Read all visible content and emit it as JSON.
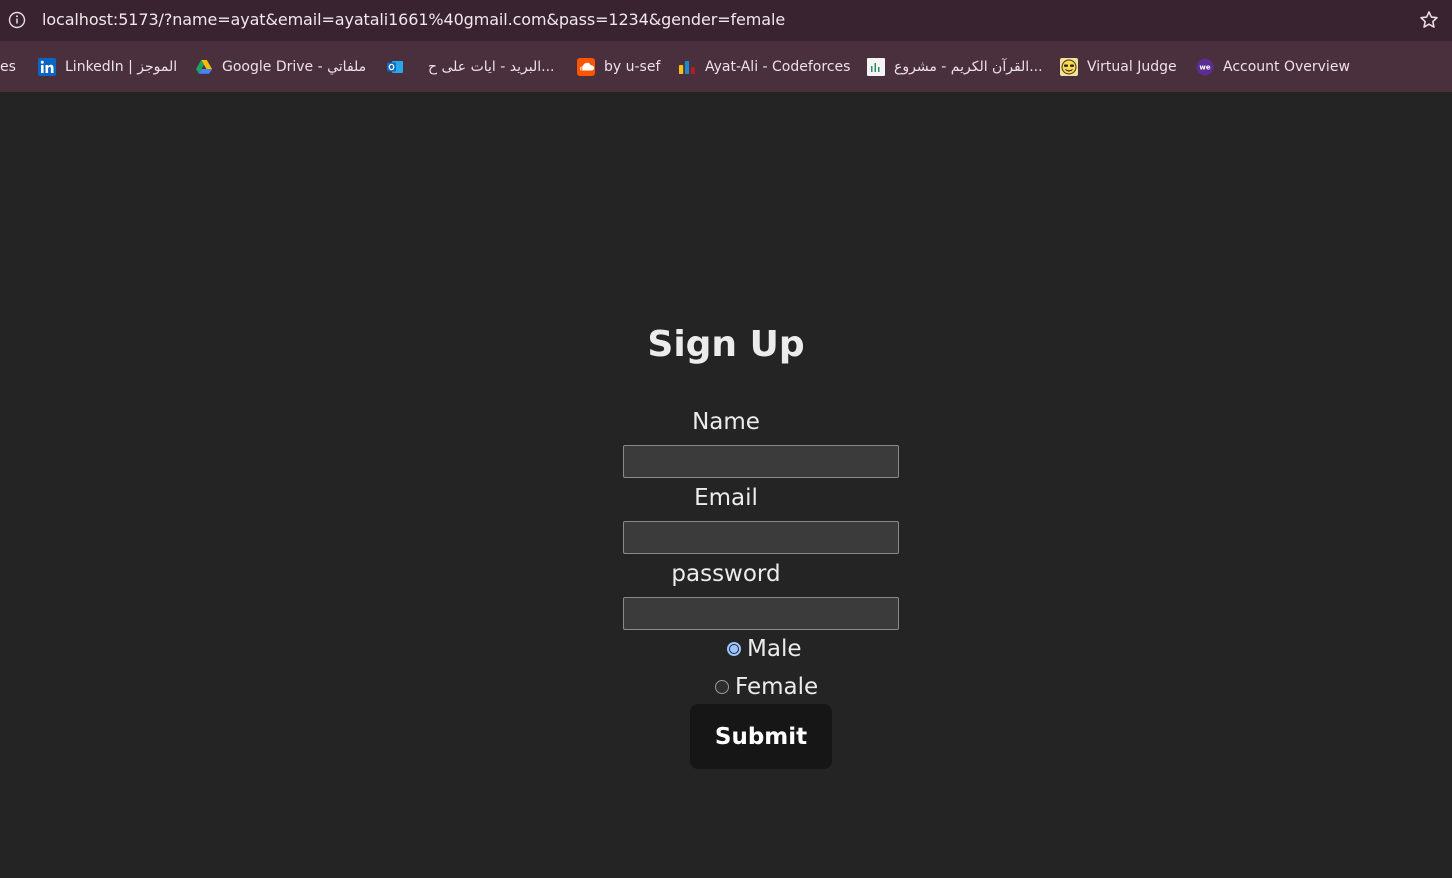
{
  "browser": {
    "url": "localhost:5173/?name=ayat&email=ayatali1661%40gmail.com&pass=1234&gender=female",
    "bookmarks": [
      {
        "label": "es",
        "icon": "folder-icon"
      },
      {
        "label": "LinkedIn | الموجز",
        "icon": "linkedin-icon",
        "color": "#0a66c2"
      },
      {
        "label": "Google Drive - ملفاتي",
        "icon": "google-drive-icon"
      },
      {
        "label": "",
        "icon": "outlook-icon",
        "color": "#0f6cbd"
      },
      {
        "label": "البريد - ايات على ح...",
        "icon": "mail-icon"
      },
      {
        "label": "by u-sef",
        "icon": "soundcloud-icon",
        "color": "#ff5500"
      },
      {
        "label": "Ayat-Ali - Codeforces",
        "icon": "codeforces-icon"
      },
      {
        "label": "القرآن الكريم - مشروع...",
        "icon": "quran-icon"
      },
      {
        "label": "Virtual Judge",
        "icon": "virtual-judge-icon"
      },
      {
        "label": "Account Overview",
        "icon": "we-icon",
        "color": "#5c2d91"
      }
    ]
  },
  "form": {
    "title": "Sign Up",
    "name_label": "Name",
    "email_label": "Email",
    "password_label": "password",
    "name_value": "",
    "email_value": "",
    "password_value": "",
    "gender_options": [
      {
        "label": "Male",
        "checked": true
      },
      {
        "label": "Female",
        "checked": false
      }
    ],
    "submit_label": "Submit"
  },
  "colors": {
    "background": "#242424",
    "address_bar": "#3a2330",
    "bookmarks_bar": "#4a2f3c",
    "radio_accent": "#9cc4ff",
    "button_bg": "#161616"
  }
}
